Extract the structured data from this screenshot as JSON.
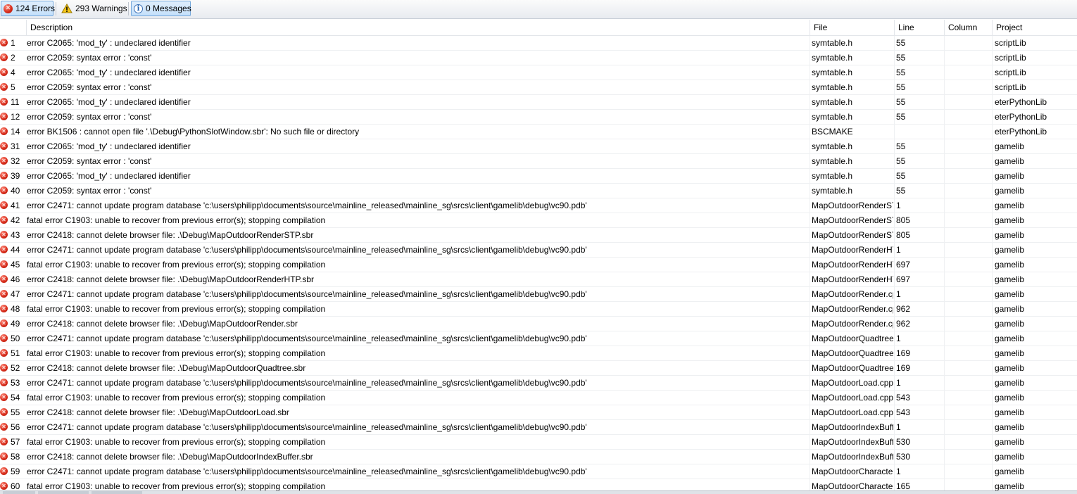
{
  "toolbar": {
    "errors_label": "124 Errors",
    "warnings_label": "293 Warnings",
    "messages_label": "0 Messages"
  },
  "columns": {
    "description": "Description",
    "file": "File",
    "line": "Line",
    "column": "Column",
    "project": "Project"
  },
  "rows": [
    {
      "num": "1",
      "desc": "error C2065: 'mod_ty' : undeclared identifier",
      "file": "symtable.h",
      "line": "55",
      "col": "",
      "project": "scriptLib"
    },
    {
      "num": "2",
      "desc": "error C2059: syntax error : 'const'",
      "file": "symtable.h",
      "line": "55",
      "col": "",
      "project": "scriptLib"
    },
    {
      "num": "4",
      "desc": "error C2065: 'mod_ty' : undeclared identifier",
      "file": "symtable.h",
      "line": "55",
      "col": "",
      "project": "scriptLib"
    },
    {
      "num": "5",
      "desc": "error C2059: syntax error : 'const'",
      "file": "symtable.h",
      "line": "55",
      "col": "",
      "project": "scriptLib"
    },
    {
      "num": "11",
      "desc": "error C2065: 'mod_ty' : undeclared identifier",
      "file": "symtable.h",
      "line": "55",
      "col": "",
      "project": "eterPythonLib"
    },
    {
      "num": "12",
      "desc": "error C2059: syntax error : 'const'",
      "file": "symtable.h",
      "line": "55",
      "col": "",
      "project": "eterPythonLib"
    },
    {
      "num": "14",
      "desc": "error BK1506 : cannot open file '.\\Debug\\PythonSlotWindow.sbr': No such file or directory",
      "file": "BSCMAKE",
      "line": "",
      "col": "",
      "project": "eterPythonLib"
    },
    {
      "num": "31",
      "desc": "error C2065: 'mod_ty' : undeclared identifier",
      "file": "symtable.h",
      "line": "55",
      "col": "",
      "project": "gamelib"
    },
    {
      "num": "32",
      "desc": "error C2059: syntax error : 'const'",
      "file": "symtable.h",
      "line": "55",
      "col": "",
      "project": "gamelib"
    },
    {
      "num": "39",
      "desc": "error C2065: 'mod_ty' : undeclared identifier",
      "file": "symtable.h",
      "line": "55",
      "col": "",
      "project": "gamelib"
    },
    {
      "num": "40",
      "desc": "error C2059: syntax error : 'const'",
      "file": "symtable.h",
      "line": "55",
      "col": "",
      "project": "gamelib"
    },
    {
      "num": "41",
      "desc": "error C2471: cannot update program database 'c:\\users\\philipp\\documents\\source\\mainline_released\\mainline_sg\\srcs\\client\\gamelib\\debug\\vc90.pdb'",
      "file": "MapOutdoorRenderSTP.cpp",
      "line": "1",
      "col": "",
      "project": "gamelib"
    },
    {
      "num": "42",
      "desc": "fatal error C1903: unable to recover from previous error(s); stopping compilation",
      "file": "MapOutdoorRenderSTP.cpp",
      "line": "805",
      "col": "",
      "project": "gamelib"
    },
    {
      "num": "43",
      "desc": "error C2418: cannot delete browser file: .\\Debug\\MapOutdoorRenderSTP.sbr",
      "file": "MapOutdoorRenderSTP.cpp",
      "line": "805",
      "col": "",
      "project": "gamelib"
    },
    {
      "num": "44",
      "desc": "error C2471: cannot update program database 'c:\\users\\philipp\\documents\\source\\mainline_released\\mainline_sg\\srcs\\client\\gamelib\\debug\\vc90.pdb'",
      "file": "MapOutdoorRenderHTP.cpp",
      "line": "1",
      "col": "",
      "project": "gamelib"
    },
    {
      "num": "45",
      "desc": "fatal error C1903: unable to recover from previous error(s); stopping compilation",
      "file": "MapOutdoorRenderHTP.cpp",
      "line": "697",
      "col": "",
      "project": "gamelib"
    },
    {
      "num": "46",
      "desc": "error C2418: cannot delete browser file: .\\Debug\\MapOutdoorRenderHTP.sbr",
      "file": "MapOutdoorRenderHTP.cpp",
      "line": "697",
      "col": "",
      "project": "gamelib"
    },
    {
      "num": "47",
      "desc": "error C2471: cannot update program database 'c:\\users\\philipp\\documents\\source\\mainline_released\\mainline_sg\\srcs\\client\\gamelib\\debug\\vc90.pdb'",
      "file": "MapOutdoorRender.cpp",
      "line": "1",
      "col": "",
      "project": "gamelib"
    },
    {
      "num": "48",
      "desc": "fatal error C1903: unable to recover from previous error(s); stopping compilation",
      "file": "MapOutdoorRender.cpp",
      "line": "962",
      "col": "",
      "project": "gamelib"
    },
    {
      "num": "49",
      "desc": "error C2418: cannot delete browser file: .\\Debug\\MapOutdoorRender.sbr",
      "file": "MapOutdoorRender.cpp",
      "line": "962",
      "col": "",
      "project": "gamelib"
    },
    {
      "num": "50",
      "desc": "error C2471: cannot update program database 'c:\\users\\philipp\\documents\\source\\mainline_released\\mainline_sg\\srcs\\client\\gamelib\\debug\\vc90.pdb'",
      "file": "MapOutdoorQuadtree.cpp",
      "line": "1",
      "col": "",
      "project": "gamelib"
    },
    {
      "num": "51",
      "desc": "fatal error C1903: unable to recover from previous error(s); stopping compilation",
      "file": "MapOutdoorQuadtree.cpp",
      "line": "169",
      "col": "",
      "project": "gamelib"
    },
    {
      "num": "52",
      "desc": "error C2418: cannot delete browser file: .\\Debug\\MapOutdoorQuadtree.sbr",
      "file": "MapOutdoorQuadtree.cpp",
      "line": "169",
      "col": "",
      "project": "gamelib"
    },
    {
      "num": "53",
      "desc": "error C2471: cannot update program database 'c:\\users\\philipp\\documents\\source\\mainline_released\\mainline_sg\\srcs\\client\\gamelib\\debug\\vc90.pdb'",
      "file": "MapOutdoorLoad.cpp",
      "line": "1",
      "col": "",
      "project": "gamelib"
    },
    {
      "num": "54",
      "desc": "fatal error C1903: unable to recover from previous error(s); stopping compilation",
      "file": "MapOutdoorLoad.cpp",
      "line": "543",
      "col": "",
      "project": "gamelib"
    },
    {
      "num": "55",
      "desc": "error C2418: cannot delete browser file: .\\Debug\\MapOutdoorLoad.sbr",
      "file": "MapOutdoorLoad.cpp",
      "line": "543",
      "col": "",
      "project": "gamelib"
    },
    {
      "num": "56",
      "desc": "error C2471: cannot update program database 'c:\\users\\philipp\\documents\\source\\mainline_released\\mainline_sg\\srcs\\client\\gamelib\\debug\\vc90.pdb'",
      "file": "MapOutdoorIndexBuffer.cpp",
      "line": "1",
      "col": "",
      "project": "gamelib"
    },
    {
      "num": "57",
      "desc": "fatal error C1903: unable to recover from previous error(s); stopping compilation",
      "file": "MapOutdoorIndexBuffer.cpp",
      "line": "530",
      "col": "",
      "project": "gamelib"
    },
    {
      "num": "58",
      "desc": "error C2418: cannot delete browser file: .\\Debug\\MapOutdoorIndexBuffer.sbr",
      "file": "MapOutdoorIndexBuffer.cpp",
      "line": "530",
      "col": "",
      "project": "gamelib"
    },
    {
      "num": "59",
      "desc": "error C2471: cannot update program database 'c:\\users\\philipp\\documents\\source\\mainline_released\\mainline_sg\\srcs\\client\\gamelib\\debug\\vc90.pdb'",
      "file": "MapOutdoorCharacterShadow.cpp",
      "line": "1",
      "col": "",
      "project": "gamelib"
    },
    {
      "num": "60",
      "desc": "fatal error C1903: unable to recover from previous error(s); stopping compilation",
      "file": "MapOutdoorCharacterShadow.cpp",
      "line": "165",
      "col": "",
      "project": "gamelib"
    }
  ],
  "icons": {
    "error": "error-icon",
    "warning": "warning-icon",
    "info": "info-icon"
  },
  "colors": {
    "error_red": "#d62b1a",
    "warning_yellow": "#f5c518",
    "info_blue": "#1f5fae",
    "toggle_pressed": "#c4e0fb"
  }
}
